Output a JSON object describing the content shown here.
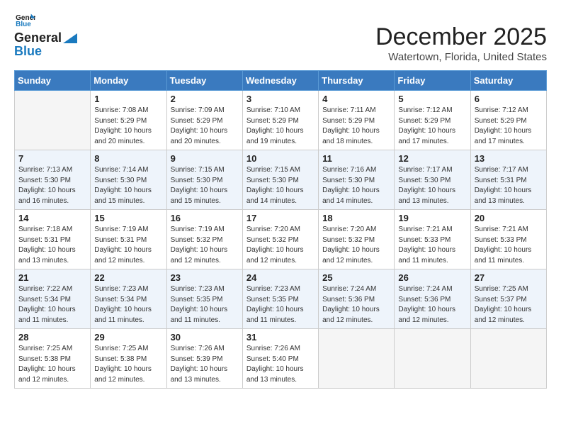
{
  "logo": {
    "line1": "General",
    "line2": "Blue"
  },
  "title": "December 2025",
  "location": "Watertown, Florida, United States",
  "days_of_week": [
    "Sunday",
    "Monday",
    "Tuesday",
    "Wednesday",
    "Thursday",
    "Friday",
    "Saturday"
  ],
  "weeks": [
    [
      {
        "day": "",
        "info": ""
      },
      {
        "day": "1",
        "info": "Sunrise: 7:08 AM\nSunset: 5:29 PM\nDaylight: 10 hours\nand 20 minutes."
      },
      {
        "day": "2",
        "info": "Sunrise: 7:09 AM\nSunset: 5:29 PM\nDaylight: 10 hours\nand 20 minutes."
      },
      {
        "day": "3",
        "info": "Sunrise: 7:10 AM\nSunset: 5:29 PM\nDaylight: 10 hours\nand 19 minutes."
      },
      {
        "day": "4",
        "info": "Sunrise: 7:11 AM\nSunset: 5:29 PM\nDaylight: 10 hours\nand 18 minutes."
      },
      {
        "day": "5",
        "info": "Sunrise: 7:12 AM\nSunset: 5:29 PM\nDaylight: 10 hours\nand 17 minutes."
      },
      {
        "day": "6",
        "info": "Sunrise: 7:12 AM\nSunset: 5:29 PM\nDaylight: 10 hours\nand 17 minutes."
      }
    ],
    [
      {
        "day": "7",
        "info": "Sunrise: 7:13 AM\nSunset: 5:30 PM\nDaylight: 10 hours\nand 16 minutes."
      },
      {
        "day": "8",
        "info": "Sunrise: 7:14 AM\nSunset: 5:30 PM\nDaylight: 10 hours\nand 15 minutes."
      },
      {
        "day": "9",
        "info": "Sunrise: 7:15 AM\nSunset: 5:30 PM\nDaylight: 10 hours\nand 15 minutes."
      },
      {
        "day": "10",
        "info": "Sunrise: 7:15 AM\nSunset: 5:30 PM\nDaylight: 10 hours\nand 14 minutes."
      },
      {
        "day": "11",
        "info": "Sunrise: 7:16 AM\nSunset: 5:30 PM\nDaylight: 10 hours\nand 14 minutes."
      },
      {
        "day": "12",
        "info": "Sunrise: 7:17 AM\nSunset: 5:30 PM\nDaylight: 10 hours\nand 13 minutes."
      },
      {
        "day": "13",
        "info": "Sunrise: 7:17 AM\nSunset: 5:31 PM\nDaylight: 10 hours\nand 13 minutes."
      }
    ],
    [
      {
        "day": "14",
        "info": "Sunrise: 7:18 AM\nSunset: 5:31 PM\nDaylight: 10 hours\nand 13 minutes."
      },
      {
        "day": "15",
        "info": "Sunrise: 7:19 AM\nSunset: 5:31 PM\nDaylight: 10 hours\nand 12 minutes."
      },
      {
        "day": "16",
        "info": "Sunrise: 7:19 AM\nSunset: 5:32 PM\nDaylight: 10 hours\nand 12 minutes."
      },
      {
        "day": "17",
        "info": "Sunrise: 7:20 AM\nSunset: 5:32 PM\nDaylight: 10 hours\nand 12 minutes."
      },
      {
        "day": "18",
        "info": "Sunrise: 7:20 AM\nSunset: 5:32 PM\nDaylight: 10 hours\nand 12 minutes."
      },
      {
        "day": "19",
        "info": "Sunrise: 7:21 AM\nSunset: 5:33 PM\nDaylight: 10 hours\nand 11 minutes."
      },
      {
        "day": "20",
        "info": "Sunrise: 7:21 AM\nSunset: 5:33 PM\nDaylight: 10 hours\nand 11 minutes."
      }
    ],
    [
      {
        "day": "21",
        "info": "Sunrise: 7:22 AM\nSunset: 5:34 PM\nDaylight: 10 hours\nand 11 minutes."
      },
      {
        "day": "22",
        "info": "Sunrise: 7:23 AM\nSunset: 5:34 PM\nDaylight: 10 hours\nand 11 minutes."
      },
      {
        "day": "23",
        "info": "Sunrise: 7:23 AM\nSunset: 5:35 PM\nDaylight: 10 hours\nand 11 minutes."
      },
      {
        "day": "24",
        "info": "Sunrise: 7:23 AM\nSunset: 5:35 PM\nDaylight: 10 hours\nand 11 minutes."
      },
      {
        "day": "25",
        "info": "Sunrise: 7:24 AM\nSunset: 5:36 PM\nDaylight: 10 hours\nand 12 minutes."
      },
      {
        "day": "26",
        "info": "Sunrise: 7:24 AM\nSunset: 5:36 PM\nDaylight: 10 hours\nand 12 minutes."
      },
      {
        "day": "27",
        "info": "Sunrise: 7:25 AM\nSunset: 5:37 PM\nDaylight: 10 hours\nand 12 minutes."
      }
    ],
    [
      {
        "day": "28",
        "info": "Sunrise: 7:25 AM\nSunset: 5:38 PM\nDaylight: 10 hours\nand 12 minutes."
      },
      {
        "day": "29",
        "info": "Sunrise: 7:25 AM\nSunset: 5:38 PM\nDaylight: 10 hours\nand 12 minutes."
      },
      {
        "day": "30",
        "info": "Sunrise: 7:26 AM\nSunset: 5:39 PM\nDaylight: 10 hours\nand 13 minutes."
      },
      {
        "day": "31",
        "info": "Sunrise: 7:26 AM\nSunset: 5:40 PM\nDaylight: 10 hours\nand 13 minutes."
      },
      {
        "day": "",
        "info": ""
      },
      {
        "day": "",
        "info": ""
      },
      {
        "day": "",
        "info": ""
      }
    ]
  ]
}
